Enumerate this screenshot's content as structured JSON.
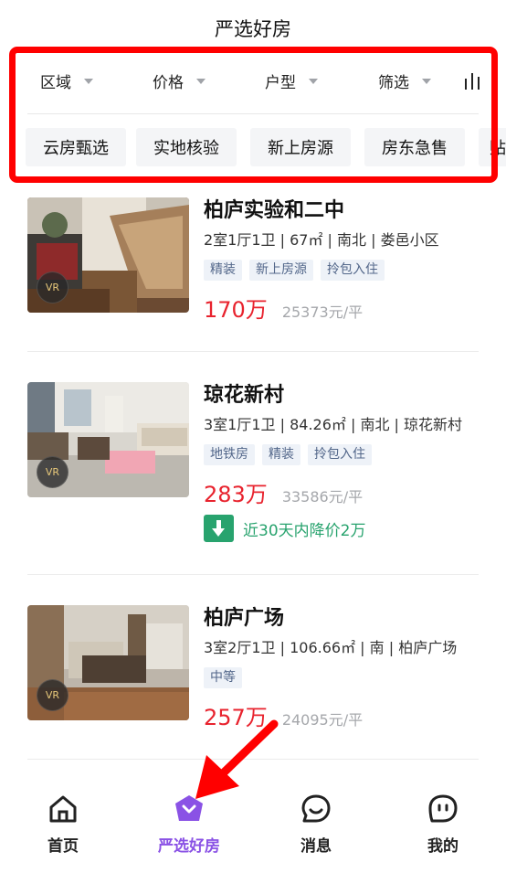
{
  "header": {
    "title": "严选好房"
  },
  "filters": [
    {
      "label": "区域"
    },
    {
      "label": "价格"
    },
    {
      "label": "户型"
    },
    {
      "label": "筛选"
    }
  ],
  "sort_icon": "sort-icon",
  "quick_tags": [
    "云房甄选",
    "实地核验",
    "新上房源",
    "房东急售",
    "贴"
  ],
  "listings": [
    {
      "title": "柏庐实验和二中",
      "desc": "2室1厅1卫 | 67㎡ | 南北 | 娄邑小区",
      "tags": [
        "精装",
        "新上房源",
        "拎包入住"
      ],
      "price": "170万",
      "unit_price": "25373元/平",
      "vr": "VR"
    },
    {
      "title": "琼花新村",
      "desc": "3室1厅1卫 | 84.26㎡ | 南北 | 琼花新村",
      "tags": [
        "地铁房",
        "精装",
        "拎包入住"
      ],
      "price": "283万",
      "unit_price": "33586元/平",
      "vr": "VR",
      "price_drop": "近30天内降价2万"
    },
    {
      "title": "柏庐广场",
      "desc": "3室2厅1卫 | 106.66㎡ | 南 | 柏庐广场",
      "tags": [
        "中等"
      ],
      "price": "257万",
      "unit_price": "24095元/平",
      "vr": "VR"
    }
  ],
  "tabbar": [
    {
      "label": "首页",
      "icon": "home-icon"
    },
    {
      "label": "严选好房",
      "icon": "selected-homes-icon",
      "active": true
    },
    {
      "label": "消息",
      "icon": "message-icon"
    },
    {
      "label": "我的",
      "icon": "profile-icon"
    }
  ],
  "colors": {
    "price_red": "#e8232e",
    "active_purple": "#8a52e5",
    "drop_green": "#28a36e",
    "annotation_red": "#ff0000"
  }
}
